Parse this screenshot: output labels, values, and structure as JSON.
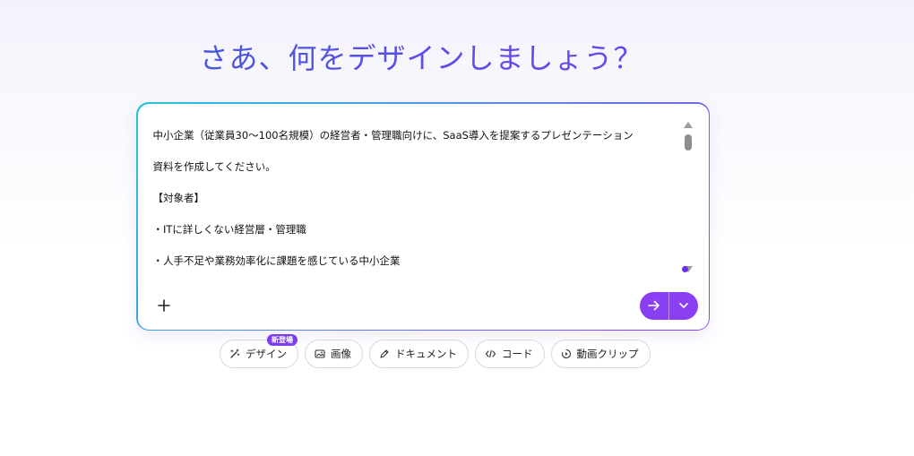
{
  "headline": "さあ、何をデザインしましょう？",
  "prompt": {
    "text": "中小企業（従業員30〜100名規模）の経営者・管理職向けに、SaaS導入を提案するプレゼンテーション\n資料を作成してください。\n【対象者】\n・ITに詳しくない経営層・管理職\n・人手不足や業務効率化に課題を感じている中小企業"
  },
  "chips": [
    {
      "label": "デザイン",
      "icon": "magic-wand-icon",
      "badge": "新登場"
    },
    {
      "label": "画像",
      "icon": "image-icon"
    },
    {
      "label": "ドキュメント",
      "icon": "pen-icon"
    },
    {
      "label": "コード",
      "icon": "code-icon"
    },
    {
      "label": "動画クリップ",
      "icon": "video-clip-icon"
    }
  ],
  "colors": {
    "accent": "#8b3ff2",
    "headline_start": "#3b5fd8",
    "headline_end": "#7d3ef0",
    "border_start": "#23c4d8"
  }
}
